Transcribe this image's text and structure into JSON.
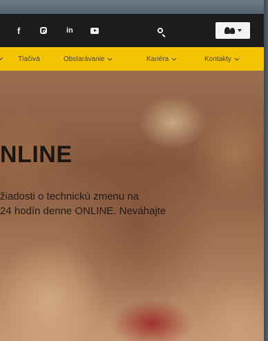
{
  "header": {
    "social_icons": [
      "facebook-icon",
      "instagram-icon",
      "linkedin-icon",
      "youtube-icon"
    ],
    "social_glyphs": {
      "facebook": "f",
      "linkedin": "in"
    }
  },
  "nav": {
    "items": [
      {
        "label": "Tlačivá",
        "has_dropdown": false
      },
      {
        "label": "Obstarávanie",
        "has_dropdown": true
      },
      {
        "label": "Kariéra",
        "has_dropdown": true
      },
      {
        "label": "Kontakty",
        "has_dropdown": true
      }
    ]
  },
  "hero": {
    "title": "NLINE",
    "line1": "žiadosti o technickú zmenu na",
    "line2": "24 hodín denne ONLINE. Neváhajte"
  },
  "colors": {
    "topbar": "#1b1c1d",
    "nav": "#f4c400",
    "nav_text": "#4c4534"
  }
}
